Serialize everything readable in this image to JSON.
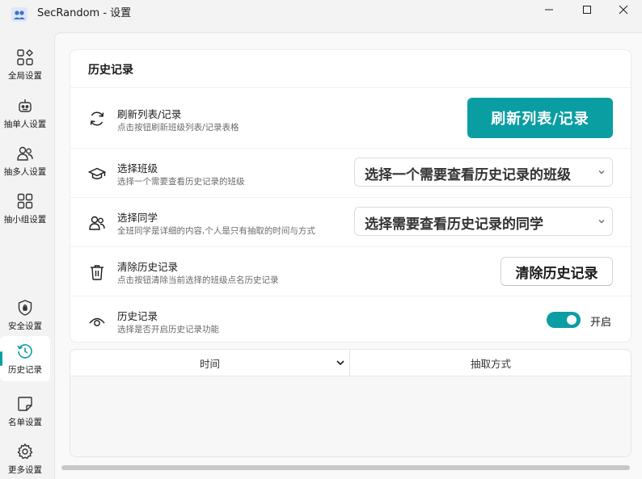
{
  "window": {
    "title": "SecRandom - 设置"
  },
  "sidebar": {
    "items": [
      {
        "label": "全局设置",
        "icon": "grid-plus-icon"
      },
      {
        "label": "抽单人设置",
        "icon": "robot-icon"
      },
      {
        "label": "抽多人设置",
        "icon": "people-icon"
      },
      {
        "label": "抽小组设置",
        "icon": "groups-icon"
      },
      {
        "label": "安全设置",
        "icon": "shield-icon"
      },
      {
        "label": "历史记录",
        "icon": "history-icon",
        "active": true
      },
      {
        "label": "名单设置",
        "icon": "note-icon"
      },
      {
        "label": "更多设置",
        "icon": "gear-icon"
      }
    ]
  },
  "history_card": {
    "title": "历史记录",
    "refresh": {
      "title": "刷新列表/记录",
      "desc": "点击按钮刷新班级列表/记录表格",
      "button": "刷新列表/记录"
    },
    "select_class": {
      "title": "选择班级",
      "desc": "选择一个需要查看历史记录的班级",
      "placeholder": "选择一个需要查看历史记录的班级"
    },
    "select_student": {
      "title": "选择同学",
      "desc": "全班同学是详细的内容,个人是只有抽取的时间与方式",
      "placeholder": "选择需要查看历史记录的同学"
    },
    "clear": {
      "title": "清除历史记录",
      "desc": "点击按钮清除当前选择的班级点名历史记录",
      "button": "清除历史记录"
    },
    "toggle": {
      "title": "历史记录",
      "desc": "选择是否开启历史记录功能",
      "state_label": "开启",
      "on": true
    }
  },
  "table": {
    "columns": [
      "时间",
      "抽取方式"
    ]
  },
  "colors": {
    "accent": "#0a9ea3"
  }
}
